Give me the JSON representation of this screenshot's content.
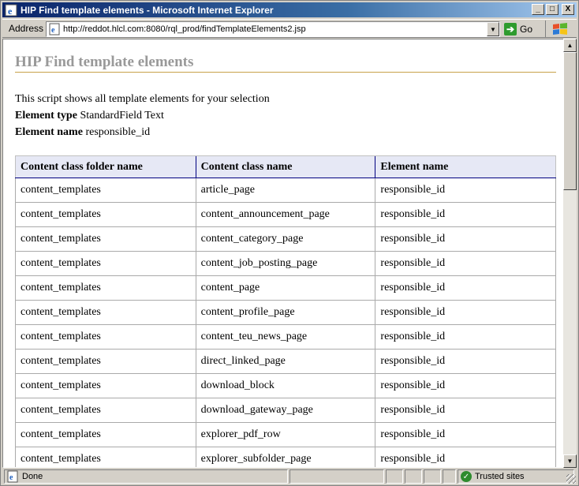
{
  "window": {
    "title": "HIP Find template elements - Microsoft Internet Explorer",
    "controls": [
      "_",
      "□",
      "X"
    ]
  },
  "address_bar": {
    "label": "Address",
    "url": "http://reddot.hlcl.com:8080/rql_prod/findTemplateElements2.jsp",
    "go_label": "Go"
  },
  "page": {
    "title": "HIP Find template elements",
    "intro": "This script shows all template elements for your selection",
    "element_type_label": "Element type",
    "element_type_value": "StandardField Text",
    "element_name_label": "Element name",
    "element_name_value": "responsible_id"
  },
  "table": {
    "headers": [
      "Content class folder name",
      "Content class name",
      "Element name"
    ],
    "rows": [
      [
        "content_templates",
        "article_page",
        "responsible_id"
      ],
      [
        "content_templates",
        "content_announcement_page",
        "responsible_id"
      ],
      [
        "content_templates",
        "content_category_page",
        "responsible_id"
      ],
      [
        "content_templates",
        "content_job_posting_page",
        "responsible_id"
      ],
      [
        "content_templates",
        "content_page",
        "responsible_id"
      ],
      [
        "content_templates",
        "content_profile_page",
        "responsible_id"
      ],
      [
        "content_templates",
        "content_teu_news_page",
        "responsible_id"
      ],
      [
        "content_templates",
        "direct_linked_page",
        "responsible_id"
      ],
      [
        "content_templates",
        "download_block",
        "responsible_id"
      ],
      [
        "content_templates",
        "download_gateway_page",
        "responsible_id"
      ],
      [
        "content_templates",
        "explorer_pdf_row",
        "responsible_id"
      ],
      [
        "content_templates",
        "explorer_subfolder_page",
        "responsible_id"
      ]
    ]
  },
  "status_bar": {
    "status": "Done",
    "zone": "Trusted sites"
  },
  "colors": {
    "title_bar": "#0a246a",
    "page_title": "#999999",
    "title_rule": "#c8a24a",
    "table_header_bg": "#e6e8f5"
  }
}
